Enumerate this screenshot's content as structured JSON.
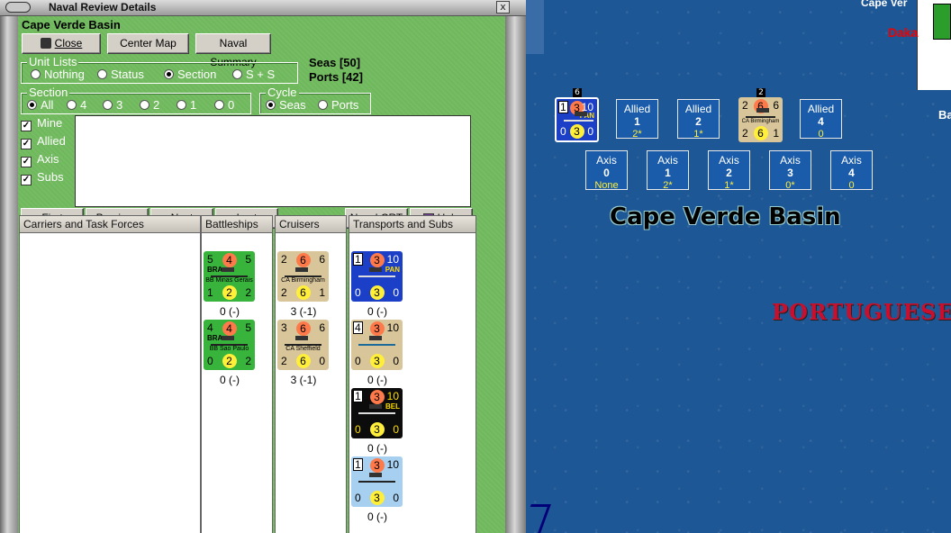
{
  "window": {
    "title": "Naval Review Details",
    "close_glyph": "x"
  },
  "region": "Cape Verde Basin",
  "buttons": {
    "close": "Close",
    "center_map": "Center Map",
    "naval_summary": "Naval Summary",
    "first": "First",
    "previous": "Previous",
    "next": "Next",
    "last": "Last",
    "naval_crt": "Naval CRT",
    "help": "Help"
  },
  "unit_lists": {
    "legend": "Unit Lists",
    "options": [
      "Nothing",
      "Status",
      "Section",
      "S + S"
    ],
    "selected": "Section"
  },
  "counts": {
    "seas": "Seas [50]",
    "ports": "Ports [42]"
  },
  "section": {
    "legend": "Section",
    "options": [
      "All",
      "4",
      "3",
      "2",
      "1",
      "0"
    ],
    "selected": "All"
  },
  "cycle": {
    "legend": "Cycle",
    "options": [
      "Seas",
      "Ports"
    ],
    "selected": "Seas"
  },
  "filters": [
    "Mine",
    "Allied",
    "Axis",
    "Subs"
  ],
  "columns": [
    "Carriers and Task Forces",
    "Battleships",
    "Cruisers",
    "Transports and Subs"
  ],
  "battleships": [
    {
      "tl": "5",
      "mt": "4",
      "tr": "5",
      "nat": "BRA",
      "name": "BB Minas Gerais",
      "bl": "1",
      "mb": "2",
      "br": "2",
      "sub": "0 (-)"
    },
    {
      "tl": "4",
      "mt": "4",
      "tr": "5",
      "nat": "BRA",
      "name": "BB Sao Paulo",
      "bl": "0",
      "mb": "2",
      "br": "2",
      "sub": "0 (-)"
    }
  ],
  "cruisers": [
    {
      "tl": "2",
      "mt": "6",
      "tr": "6",
      "name": "CA Birmingham",
      "bl": "2",
      "mb": "6",
      "br": "1",
      "sub": "3 (-1)"
    },
    {
      "tl": "3",
      "mt": "6",
      "tr": "6",
      "name": "CA Sheffield",
      "bl": "2",
      "mb": "6",
      "br": "0",
      "sub": "3 (-1)"
    }
  ],
  "transports": [
    {
      "tl": "1",
      "mt": "3",
      "tr": "10",
      "natr": "PAN",
      "bl": "0",
      "mb": "3",
      "br": "0",
      "sub": "0 (-)"
    },
    {
      "tl": "4",
      "mt": "3",
      "tr": "10",
      "bl": "0",
      "mb": "3",
      "br": "0",
      "sub": "0 (-)"
    },
    {
      "tl": "1",
      "mt": "3",
      "tr": "10",
      "natr": "BEL",
      "bl": "0",
      "mb": "3",
      "br": "0",
      "sub": "0 (-)"
    },
    {
      "tl": "1",
      "mt": "3",
      "tr": "10",
      "bl": "0",
      "mb": "3",
      "br": "0",
      "sub": "0 (-)"
    }
  ],
  "map": {
    "title": "Cape Verde Basin",
    "country": "PORTUGUESE",
    "top_label": "Cape Ver",
    "dakar": "Daka",
    "edge_label": "Ba",
    "map_counter": {
      "tl": "1",
      "mt": "3",
      "tr": "10",
      "natr": "PAN",
      "bl": "0",
      "mb": "3",
      "br": "0",
      "stack": "6"
    },
    "map_cruiser": {
      "tl": "2",
      "mt": "6",
      "tr": "6",
      "name": "CA Birmingham",
      "bl": "2",
      "mb": "6",
      "br": "1",
      "stack": "2"
    },
    "allied": [
      {
        "label": "Allied",
        "v": "1",
        "s": "2*"
      },
      {
        "label": "Allied",
        "v": "2",
        "s": "1*"
      },
      {
        "label": "Allied",
        "v": "4",
        "s": "0"
      }
    ],
    "axis": [
      {
        "label": "Axis",
        "v": "0",
        "s": "None"
      },
      {
        "label": "Axis",
        "v": "1",
        "s": "2*"
      },
      {
        "label": "Axis",
        "v": "2",
        "s": "1*"
      },
      {
        "label": "Axis",
        "v": "3",
        "s": "0*"
      },
      {
        "label": "Axis",
        "v": "4",
        "s": "0"
      }
    ]
  }
}
